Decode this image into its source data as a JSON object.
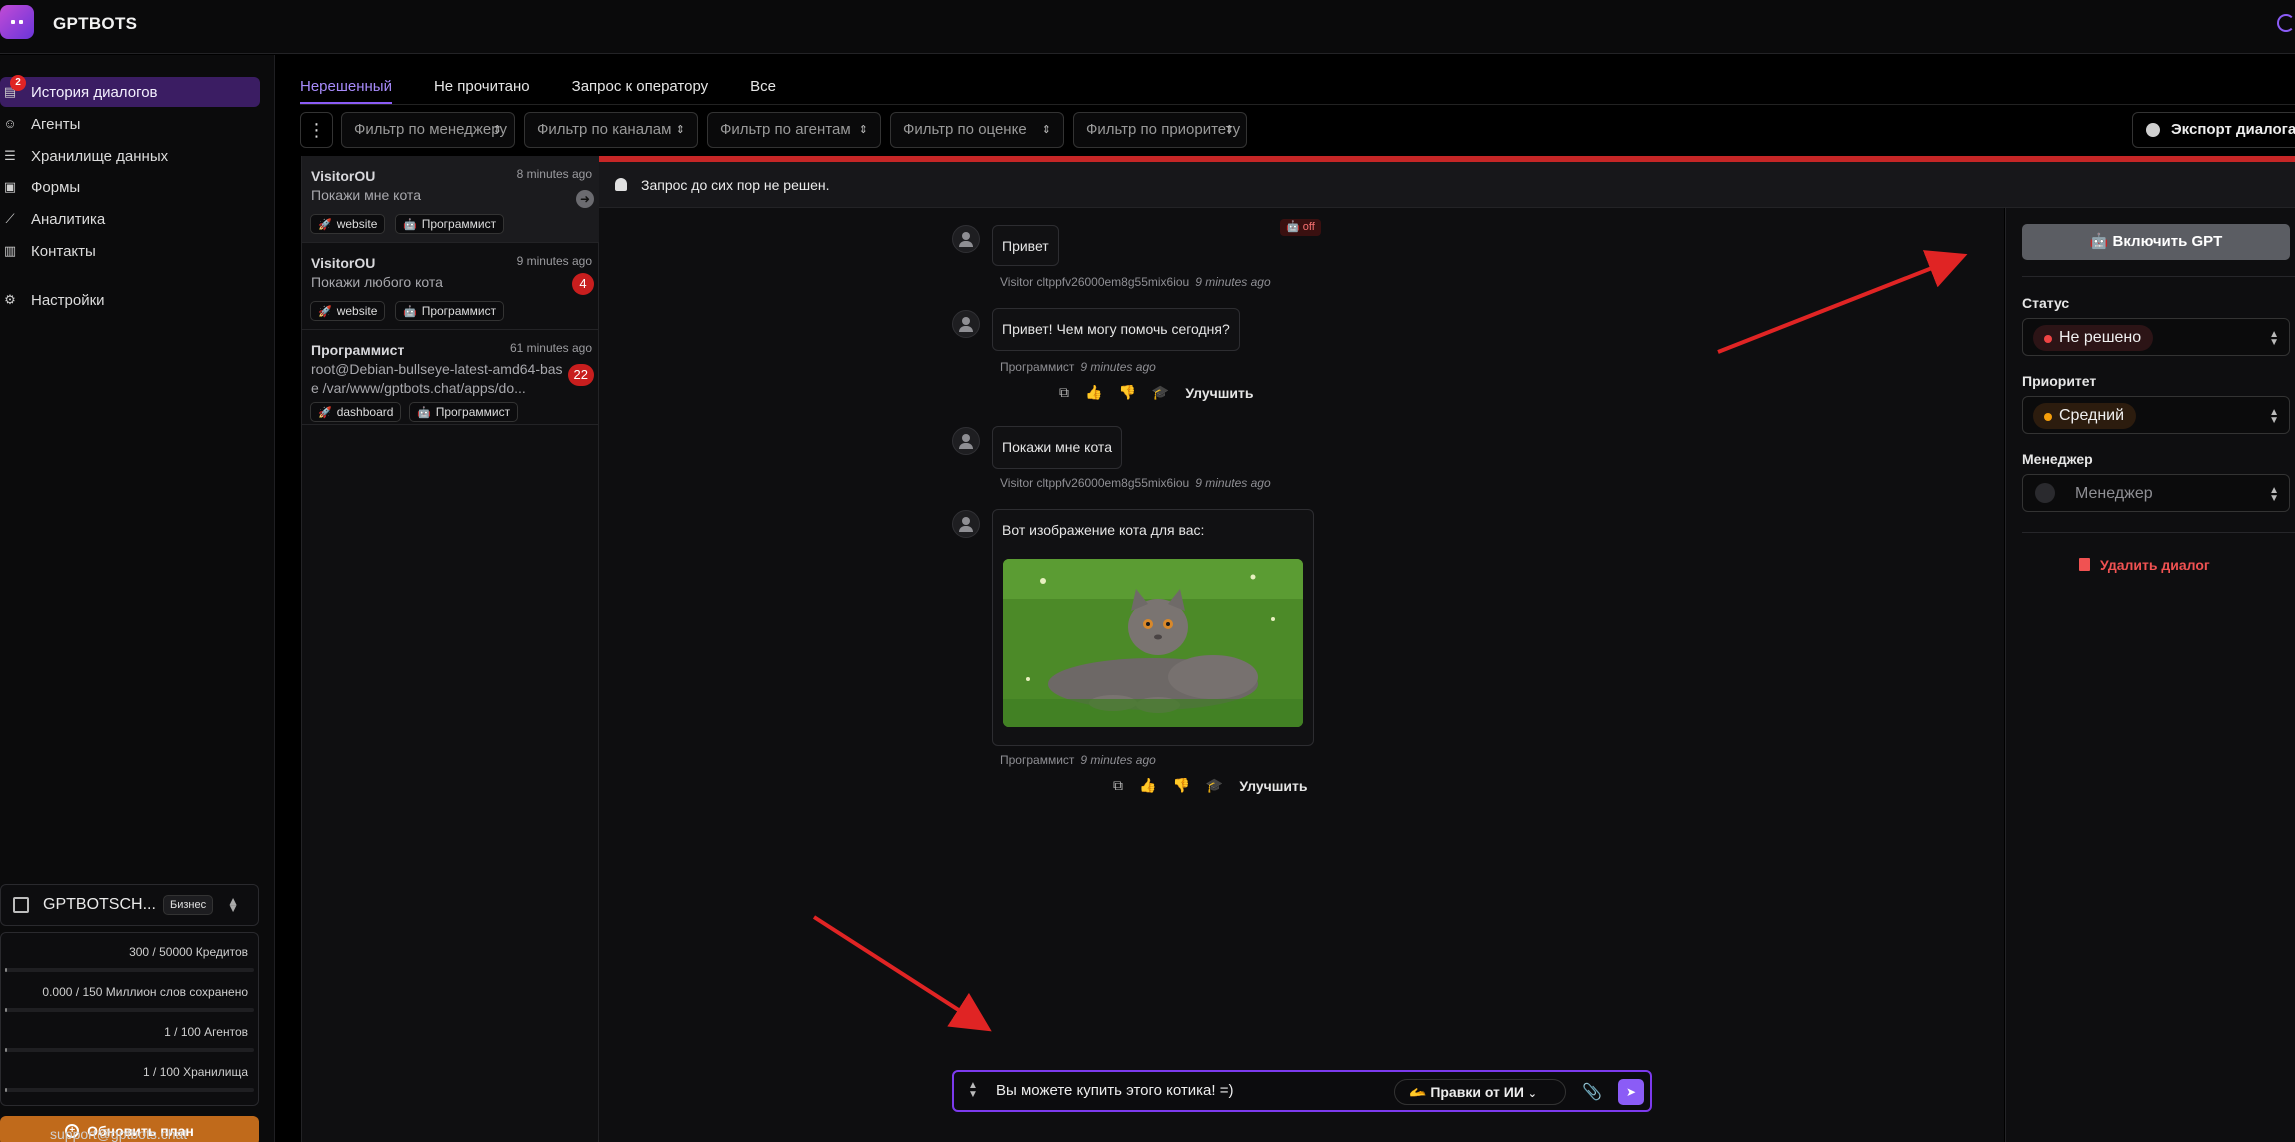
{
  "app": {
    "brand": "GPTBOTS"
  },
  "sidebar": {
    "items": [
      {
        "label": "История диалогов",
        "icon": "chat-history-icon",
        "badge": "2",
        "active": true
      },
      {
        "label": "Агенты",
        "icon": "robot-icon"
      },
      {
        "label": "Хранилище данных",
        "icon": "list-icon"
      },
      {
        "label": "Формы",
        "icon": "form-icon"
      },
      {
        "label": "Аналитика",
        "icon": "chart-line-icon"
      },
      {
        "label": "Контакты",
        "icon": "contacts-icon"
      },
      {
        "label": "Настройки",
        "icon": "user-settings-icon"
      }
    ],
    "workspace": {
      "name": "GPTBOTSCH...",
      "plan": "Бизнес"
    },
    "usage": [
      {
        "text": "300 / 50000 Кредитов",
        "fraction": 0.006
      },
      {
        "text": "0.000 / 150 Миллион слов сохранено",
        "fraction": 0.0
      },
      {
        "text": "1 / 100 Агентов",
        "fraction": 0.01
      },
      {
        "text": "1 / 100 Хранилища",
        "fraction": 0.01
      }
    ],
    "upgrade_label": "Обновить план",
    "support_email": "support@gptbots.chat"
  },
  "tabs": [
    {
      "label": "Нерешенный",
      "active": true
    },
    {
      "label": "Не прочитано"
    },
    {
      "label": "Запрос к оператору"
    },
    {
      "label": "Все"
    }
  ],
  "filters": [
    {
      "placeholder": "Фильтр по менеджеру"
    },
    {
      "placeholder": "Фильтр по каналам"
    },
    {
      "placeholder": "Фильтр по агентам"
    },
    {
      "placeholder": "Фильтр по оценке"
    },
    {
      "placeholder": "Фильтр по приоритету"
    }
  ],
  "export_label": "Экспорт диалога",
  "conversations": [
    {
      "name": "VisitorOU",
      "time": "8 minutes ago",
      "message": "Покажи мне кота",
      "channel": "website",
      "agent": "Программист",
      "selected": true
    },
    {
      "name": "VisitorOU",
      "time": "9 minutes ago",
      "message": "Покажи любого кота",
      "badge": "4",
      "channel": "website",
      "agent": "Программист"
    },
    {
      "name": "Программист",
      "time": "61 minutes ago",
      "message": "root@Debian-bullseye-latest-amd64-base /var/www/gptbots.chat/apps/do...",
      "badge": "22",
      "channel": "dashboard",
      "agent": "Программист"
    }
  ],
  "alert_text": "Запрос до сих пор не решен.",
  "off_tag": "off",
  "messages": [
    {
      "text": "Привет",
      "author": "Visitor cltppfv26000em8g55mix6iou",
      "time": "9 minutes ago"
    },
    {
      "text": "Привет! Чем могу помочь сегодня?",
      "author": "Программист",
      "time": "9 minutes ago",
      "improve_label": "Улучшить"
    },
    {
      "text": "Покажи мне кота",
      "author": "Visitor cltppfv26000em8g55mix6iou",
      "time": "9 minutes ago"
    },
    {
      "text": "Вот изображение кота для вас:",
      "author": "Программист",
      "time": "9 minutes ago",
      "improve_label": "Улучшить",
      "image": "grey-cat-on-grass"
    }
  ],
  "composer": {
    "value": "Вы можете купить этого котика! =)",
    "ai_edit_label": "🫴 Правки от ИИ"
  },
  "right_panel": {
    "gpt_button": "Включить GPT",
    "status_label": "Статус",
    "status_value": "Не решено",
    "priority_label": "Приоритет",
    "priority_value": "Средний",
    "manager_label": "Менеджер",
    "manager_placeholder": "Менеджер",
    "delete_label": "Удалить диалог"
  },
  "colors": {
    "accent": "#8b5cf6",
    "danger": "#c62626",
    "upgrade": "#c06a1b",
    "annotation_arrow": "#e02424"
  }
}
